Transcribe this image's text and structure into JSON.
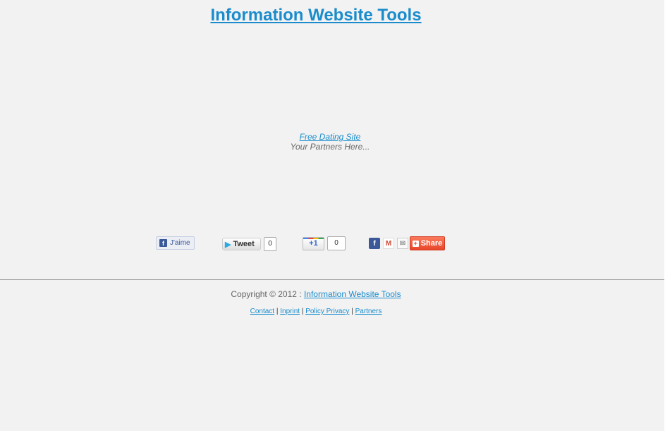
{
  "header": {
    "title": "Information Website Tools"
  },
  "partners": {
    "link_label": "Free Dating Site",
    "tagline": "Your Partners Here..."
  },
  "social": {
    "facebook_like_label": "J'aime",
    "tweet_label": "Tweet",
    "tweet_count": "0",
    "gplus_label": "+1",
    "gplus_count": "0",
    "share_label": "Share",
    "facebook_glyph": "f",
    "gmail_glyph": "M",
    "mail_glyph": "✉",
    "bird_glyph": "🐦",
    "share_plus_glyph": "+"
  },
  "footer": {
    "copyright_prefix": "Copyright © 2012 : ",
    "copyright_link": "Information Website Tools",
    "links": {
      "contact": "Contact",
      "inprint": "Inprint",
      "policy_privacy": "Policy Privacy",
      "partners": "Partners"
    },
    "separator": " | "
  },
  "colors": {
    "background": "#f2f2f2",
    "accent": "#1a8ccc",
    "text_gray": "#666666",
    "facebook": "#3b5998",
    "share_orange": "#e8462a"
  }
}
